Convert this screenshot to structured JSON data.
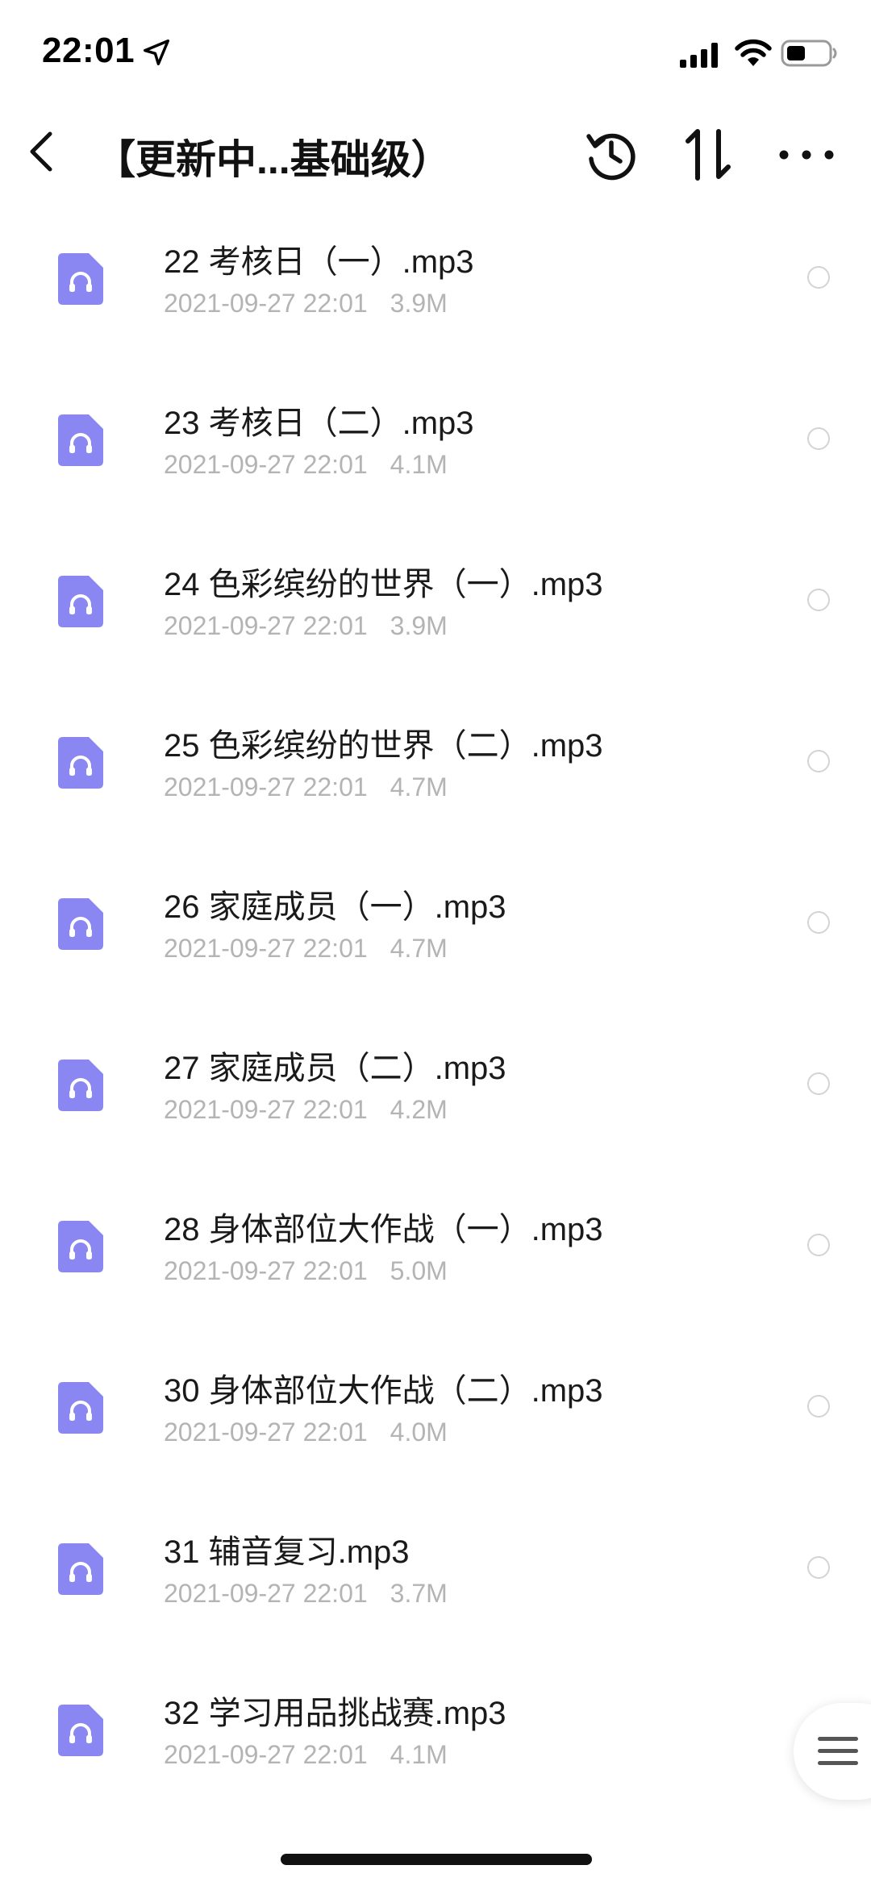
{
  "status_bar": {
    "time": "22:01",
    "location_icon": "location-arrow-icon",
    "signal_icon": "cellular-signal-icon",
    "wifi_icon": "wifi-icon",
    "battery_icon": "battery-icon"
  },
  "nav": {
    "back_icon": "chevron-left-icon",
    "title": "【更新中...基础级）",
    "history_icon": "history-icon",
    "sort_icon": "sort-icon",
    "more_icon": "more-icon"
  },
  "colors": {
    "file_icon": "#8a86f2",
    "meta_text": "#b4b4b4"
  },
  "files": [
    {
      "name": "22 考核日（一）.mp3",
      "date": "2021-09-27 22:01",
      "size": "3.9M"
    },
    {
      "name": "23 考核日（二）.mp3",
      "date": "2021-09-27 22:01",
      "size": "4.1M"
    },
    {
      "name": "24 色彩缤纷的世界（一）.mp3",
      "date": "2021-09-27 22:01",
      "size": "3.9M"
    },
    {
      "name": "25 色彩缤纷的世界（二）.mp3",
      "date": "2021-09-27 22:01",
      "size": "4.7M"
    },
    {
      "name": "26 家庭成员（一）.mp3",
      "date": "2021-09-27 22:01",
      "size": "4.7M"
    },
    {
      "name": "27 家庭成员（二）.mp3",
      "date": "2021-09-27 22:01",
      "size": "4.2M"
    },
    {
      "name": "28 身体部位大作战（一）.mp3",
      "date": "2021-09-27 22:01",
      "size": "5.0M"
    },
    {
      "name": "30 身体部位大作战（二）.mp3",
      "date": "2021-09-27 22:01",
      "size": "4.0M"
    },
    {
      "name": "31 辅音复习.mp3",
      "date": "2021-09-27 22:01",
      "size": "3.7M"
    },
    {
      "name": "32 学习用品挑战赛.mp3",
      "date": "2021-09-27 22:01",
      "size": "4.1M"
    }
  ],
  "floating_menu_icon": "menu-icon"
}
